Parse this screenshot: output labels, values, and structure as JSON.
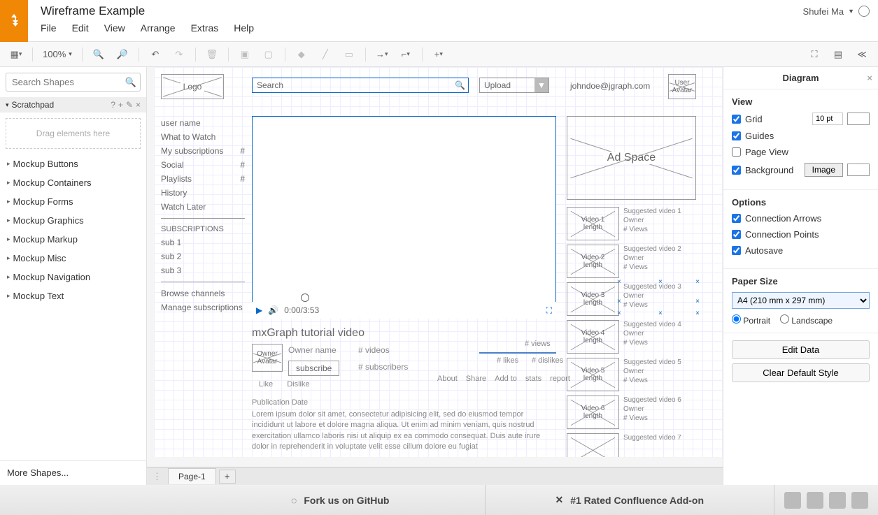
{
  "header": {
    "title": "Wireframe Example",
    "menu": [
      "File",
      "Edit",
      "View",
      "Arrange",
      "Extras",
      "Help"
    ],
    "user": "Shufei Ma"
  },
  "toolbar": {
    "zoom": "100%"
  },
  "left": {
    "search_placeholder": "Search Shapes",
    "scratchpad_label": "Scratchpad",
    "drag_hint": "Drag elements here",
    "categories": [
      "Mockup Buttons",
      "Mockup Containers",
      "Mockup Forms",
      "Mockup Graphics",
      "Mockup Markup",
      "Mockup Misc",
      "Mockup Navigation",
      "Mockup Text"
    ],
    "more": "More Shapes..."
  },
  "canvas": {
    "logo": "Logo",
    "search_placeholder": "Search",
    "upload": "Upload",
    "email": "johndoe@jgraph.com",
    "avatar_l1": "User",
    "avatar_l2": "Avatar",
    "sidenav": {
      "items": [
        {
          "label": "user name",
          "badge": ""
        },
        {
          "label": "What to Watch",
          "badge": ""
        },
        {
          "label": "My subscriptions",
          "badge": "#"
        },
        {
          "label": "Social",
          "badge": "#"
        },
        {
          "label": "Playlists",
          "badge": "#"
        },
        {
          "label": "History",
          "badge": ""
        },
        {
          "label": "Watch Later",
          "badge": ""
        }
      ],
      "subs_head": "SUBSCRIPTIONS",
      "subs": [
        "sub 1",
        "sub 2",
        "sub 3"
      ],
      "browse": "Browse channels",
      "manage": "Manage subscriptions"
    },
    "video": {
      "time": "0:00/3:53",
      "title": "mxGraph tutorial video"
    },
    "owner": {
      "av_l1": "Owner",
      "av_l2": "Avatar",
      "name": "Owner name",
      "videos": "# videos",
      "subscribe": "subscribe",
      "subscribers": "# subscribers"
    },
    "stats": {
      "views": "# views",
      "likes": "# likes",
      "dislikes": "# dislikes"
    },
    "actions": [
      "About",
      "Share",
      "Add to",
      "stats",
      "report"
    ],
    "like_row": [
      "Like",
      "Dislike"
    ],
    "pubdate": "Publication Date",
    "lorem": "Lorem ipsum dolor sit amet, consectetur adipisicing elit, sed do eiusmod tempor incididunt ut labore et dolore magna aliqua. Ut enim ad minim veniam, quis nostrud exercitation ullamco laboris nisi ut aliquip ex ea commodo consequat. Duis aute irure dolor in reprehenderit in voluptate velit esse cillum dolore eu fugiat",
    "ad": "Ad Space",
    "suggested": [
      {
        "thumb_l1": "Video 1",
        "thumb_l2": "length",
        "title": "Suggested video 1",
        "owner": "Owner",
        "views": "# Views"
      },
      {
        "thumb_l1": "Video 2",
        "thumb_l2": "length",
        "title": "Suggested video 2",
        "owner": "Owner",
        "views": "# Views"
      },
      {
        "thumb_l1": "Video 3",
        "thumb_l2": "length",
        "title": "Suggested video 3",
        "owner": "Owner",
        "views": "# Views"
      },
      {
        "thumb_l1": "Video 4",
        "thumb_l2": "length",
        "title": "Suggested video 4",
        "owner": "Owner",
        "views": "# Views"
      },
      {
        "thumb_l1": "Video 5",
        "thumb_l2": "length",
        "title": "Suggested video 5",
        "owner": "Owner",
        "views": "# Views"
      },
      {
        "thumb_l1": "Video 6",
        "thumb_l2": "length",
        "title": "Suggested video 6",
        "owner": "Owner",
        "views": "# Views"
      },
      {
        "thumb_l1": "",
        "thumb_l2": "",
        "title": "Suggested video 7",
        "owner": "",
        "views": ""
      }
    ],
    "page_tab": "Page-1"
  },
  "right": {
    "title": "Diagram",
    "view_head": "View",
    "grid": "Grid",
    "grid_val": "10 pt",
    "guides": "Guides",
    "pageview": "Page View",
    "background": "Background",
    "image_btn": "Image",
    "options_head": "Options",
    "conn_arrows": "Connection Arrows",
    "conn_points": "Connection Points",
    "autosave": "Autosave",
    "paper_head": "Paper Size",
    "paper_val": "A4 (210 mm x 297 mm)",
    "portrait": "Portrait",
    "landscape": "Landscape",
    "edit_data": "Edit Data",
    "clear_style": "Clear Default Style"
  },
  "footer": {
    "fork": "Fork us on GitHub",
    "confluence": "#1 Rated Confluence Add-on"
  }
}
